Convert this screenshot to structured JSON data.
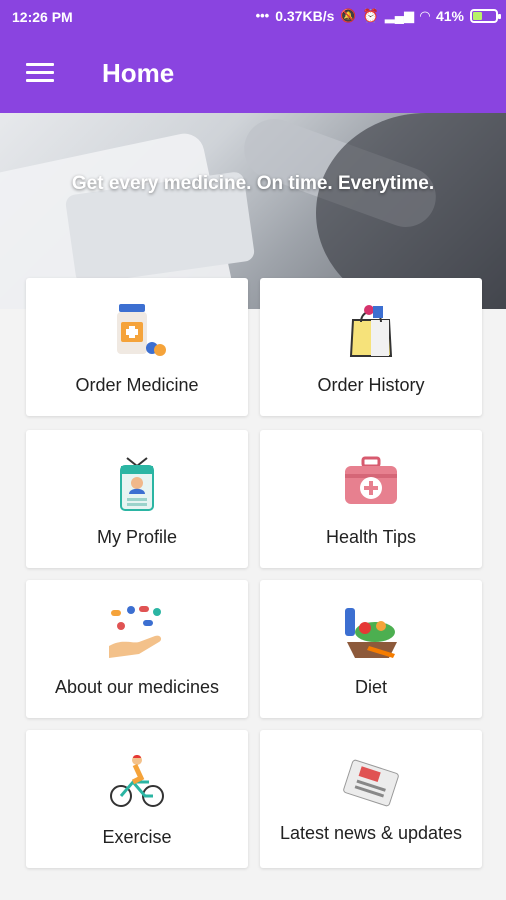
{
  "status_bar": {
    "time": "12:26 PM",
    "dots": "•••",
    "network_speed": "0.37KB/s",
    "battery": "41%",
    "battery_level": 0.41
  },
  "app_bar": {
    "title": "Home",
    "menu_icon": "hamburger-menu-icon"
  },
  "banner": {
    "text": "Get every medicine. On time. Everytime."
  },
  "tiles": [
    {
      "label": "Order Medicine",
      "icon": "medicine-bottle-icon"
    },
    {
      "label": "Order History",
      "icon": "shopping-bag-icon"
    },
    {
      "label": "My Profile",
      "icon": "id-badge-icon"
    },
    {
      "label": "Health Tips",
      "icon": "first-aid-kit-icon"
    },
    {
      "label": "About our medicines",
      "icon": "pills-hand-icon"
    },
    {
      "label": "Diet",
      "icon": "vegetables-icon"
    },
    {
      "label": "Exercise",
      "icon": "cyclist-icon"
    },
    {
      "label": "Latest news & updates",
      "icon": "newspaper-icon"
    }
  ]
}
